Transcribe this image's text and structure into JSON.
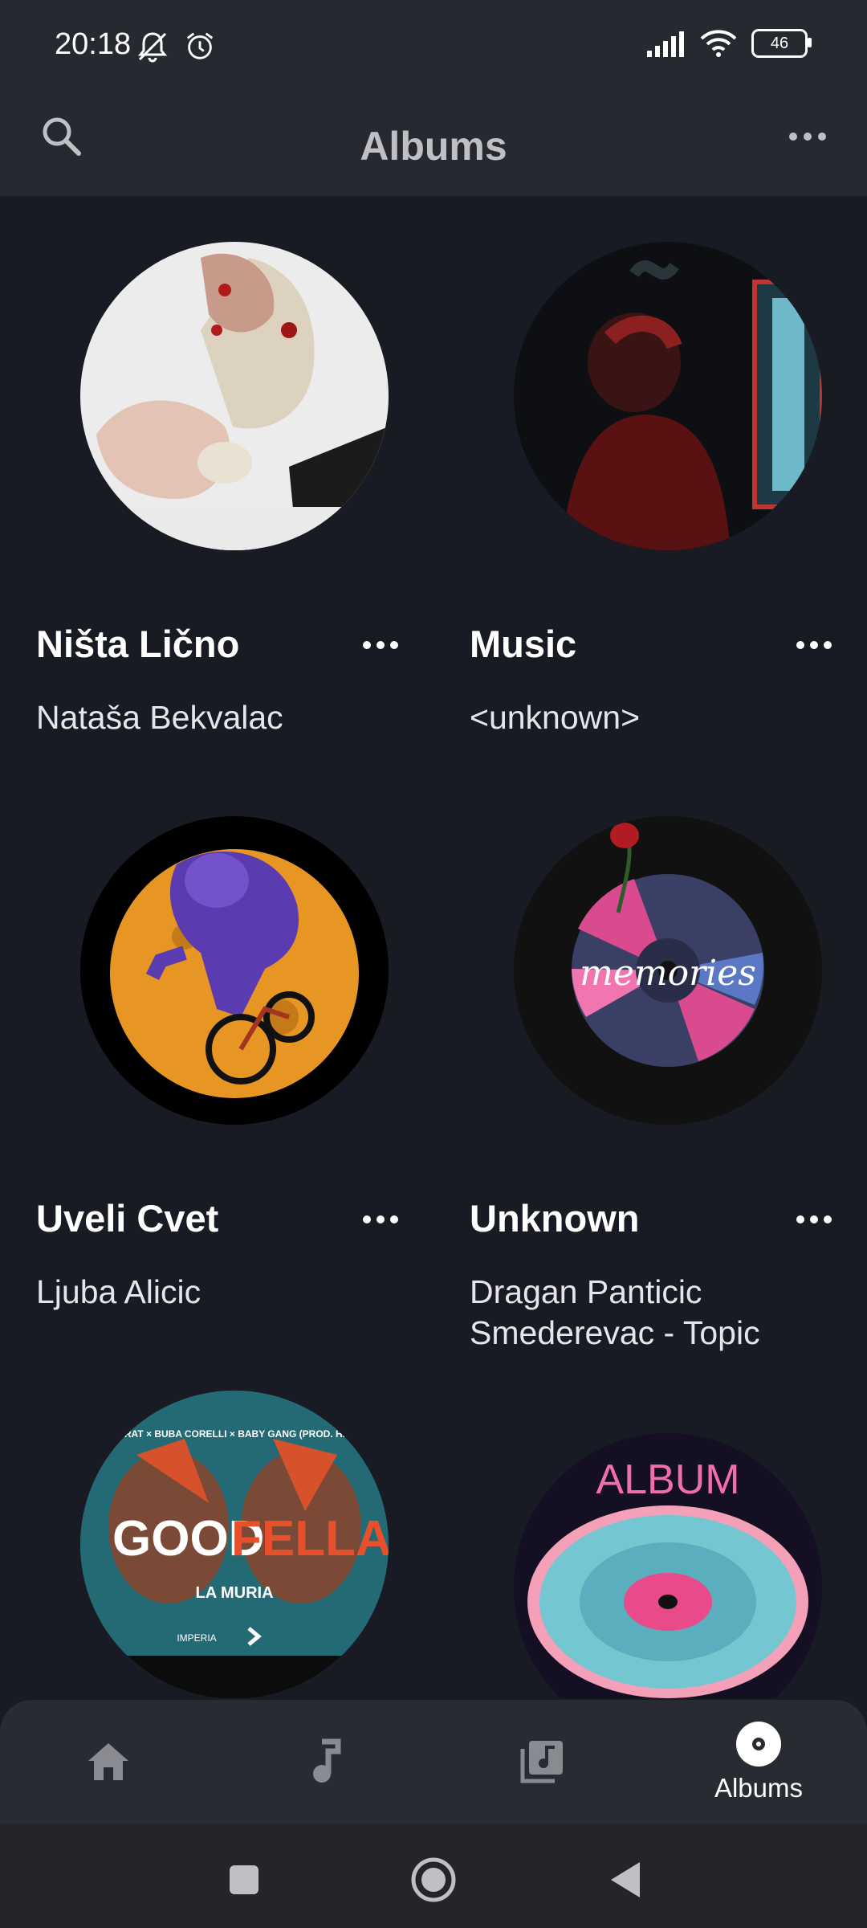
{
  "status_bar": {
    "time": "20:18",
    "battery": "46"
  },
  "header": {
    "title": "Albums"
  },
  "albums": [
    {
      "title": "Ništa Lično",
      "artist": "Nataša Bekvalac"
    },
    {
      "title": "Music",
      "artist": "<unknown>"
    },
    {
      "title": "Uveli Cvet",
      "artist": "Ljuba Alicic"
    },
    {
      "title": "Unknown",
      "artist": "Dragan Panticic Smederevac - Topic"
    },
    {
      "title": "",
      "artist": ""
    },
    {
      "title": "",
      "artist": ""
    }
  ],
  "artwork_text": {
    "goodfellas_top": "JALA BRAT × BUBA CORELLI × BABY GANG (PROD. HIGASHI)",
    "goodfellas_main_1": "GOOD",
    "goodfellas_main_2": "FELLAS",
    "goodfellas_sub": "LA MURIA",
    "goodfellas_brand": "IMPERIA",
    "album_word": "ALBUM",
    "memories_word": "memories"
  },
  "bottom_nav": [
    {
      "icon": "home-icon",
      "label": ""
    },
    {
      "icon": "music-note-icon",
      "label": ""
    },
    {
      "icon": "library-icon",
      "label": ""
    },
    {
      "icon": "album-icon",
      "label": "Albums"
    }
  ],
  "colors": {
    "background": "#181b23",
    "bar": "#272930",
    "text": "#ffffff"
  }
}
